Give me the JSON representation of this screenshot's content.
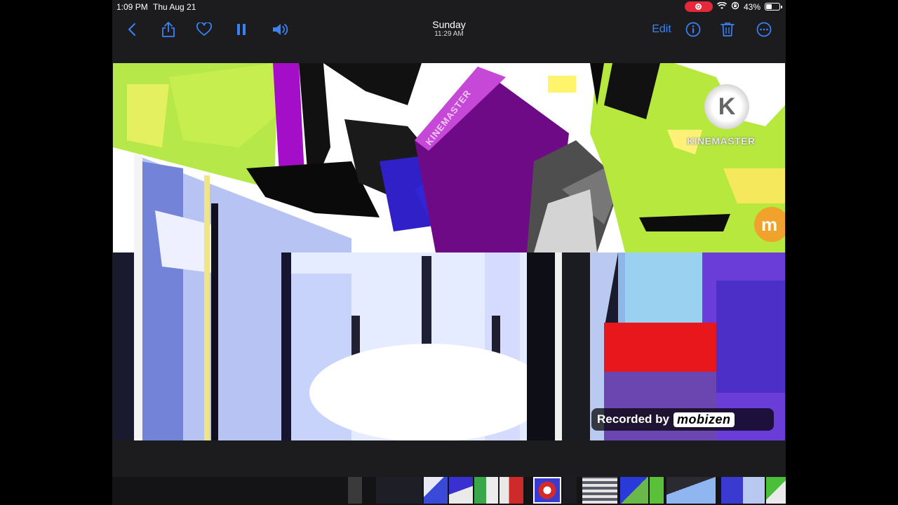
{
  "status_bar": {
    "time": "1:09 PM",
    "date": "Thu Aug 21",
    "battery_percent": "43%",
    "battery_level": 0.43,
    "recording_indicator_color": "#e5283a"
  },
  "toolbar": {
    "title": "Sunday",
    "subtitle": "11:29 AM",
    "edit_label": "Edit",
    "accent_color": "#3a82f7",
    "icons": [
      "back-chevron-icon",
      "share-icon",
      "heart-icon",
      "pause-icon",
      "volume-icon",
      "info-icon",
      "trash-icon",
      "more-icon"
    ]
  },
  "video": {
    "watermark_kinemaster": "KINEMASTER",
    "watermark_kinemaster_logo": "K",
    "mobizen_badge": "m",
    "recorded_by_label": "Recorded by",
    "recorded_by_brand": "mobizen",
    "tilted_label": "KINEMASTER"
  },
  "filmstrip": {
    "thumbnail_count": 14
  }
}
